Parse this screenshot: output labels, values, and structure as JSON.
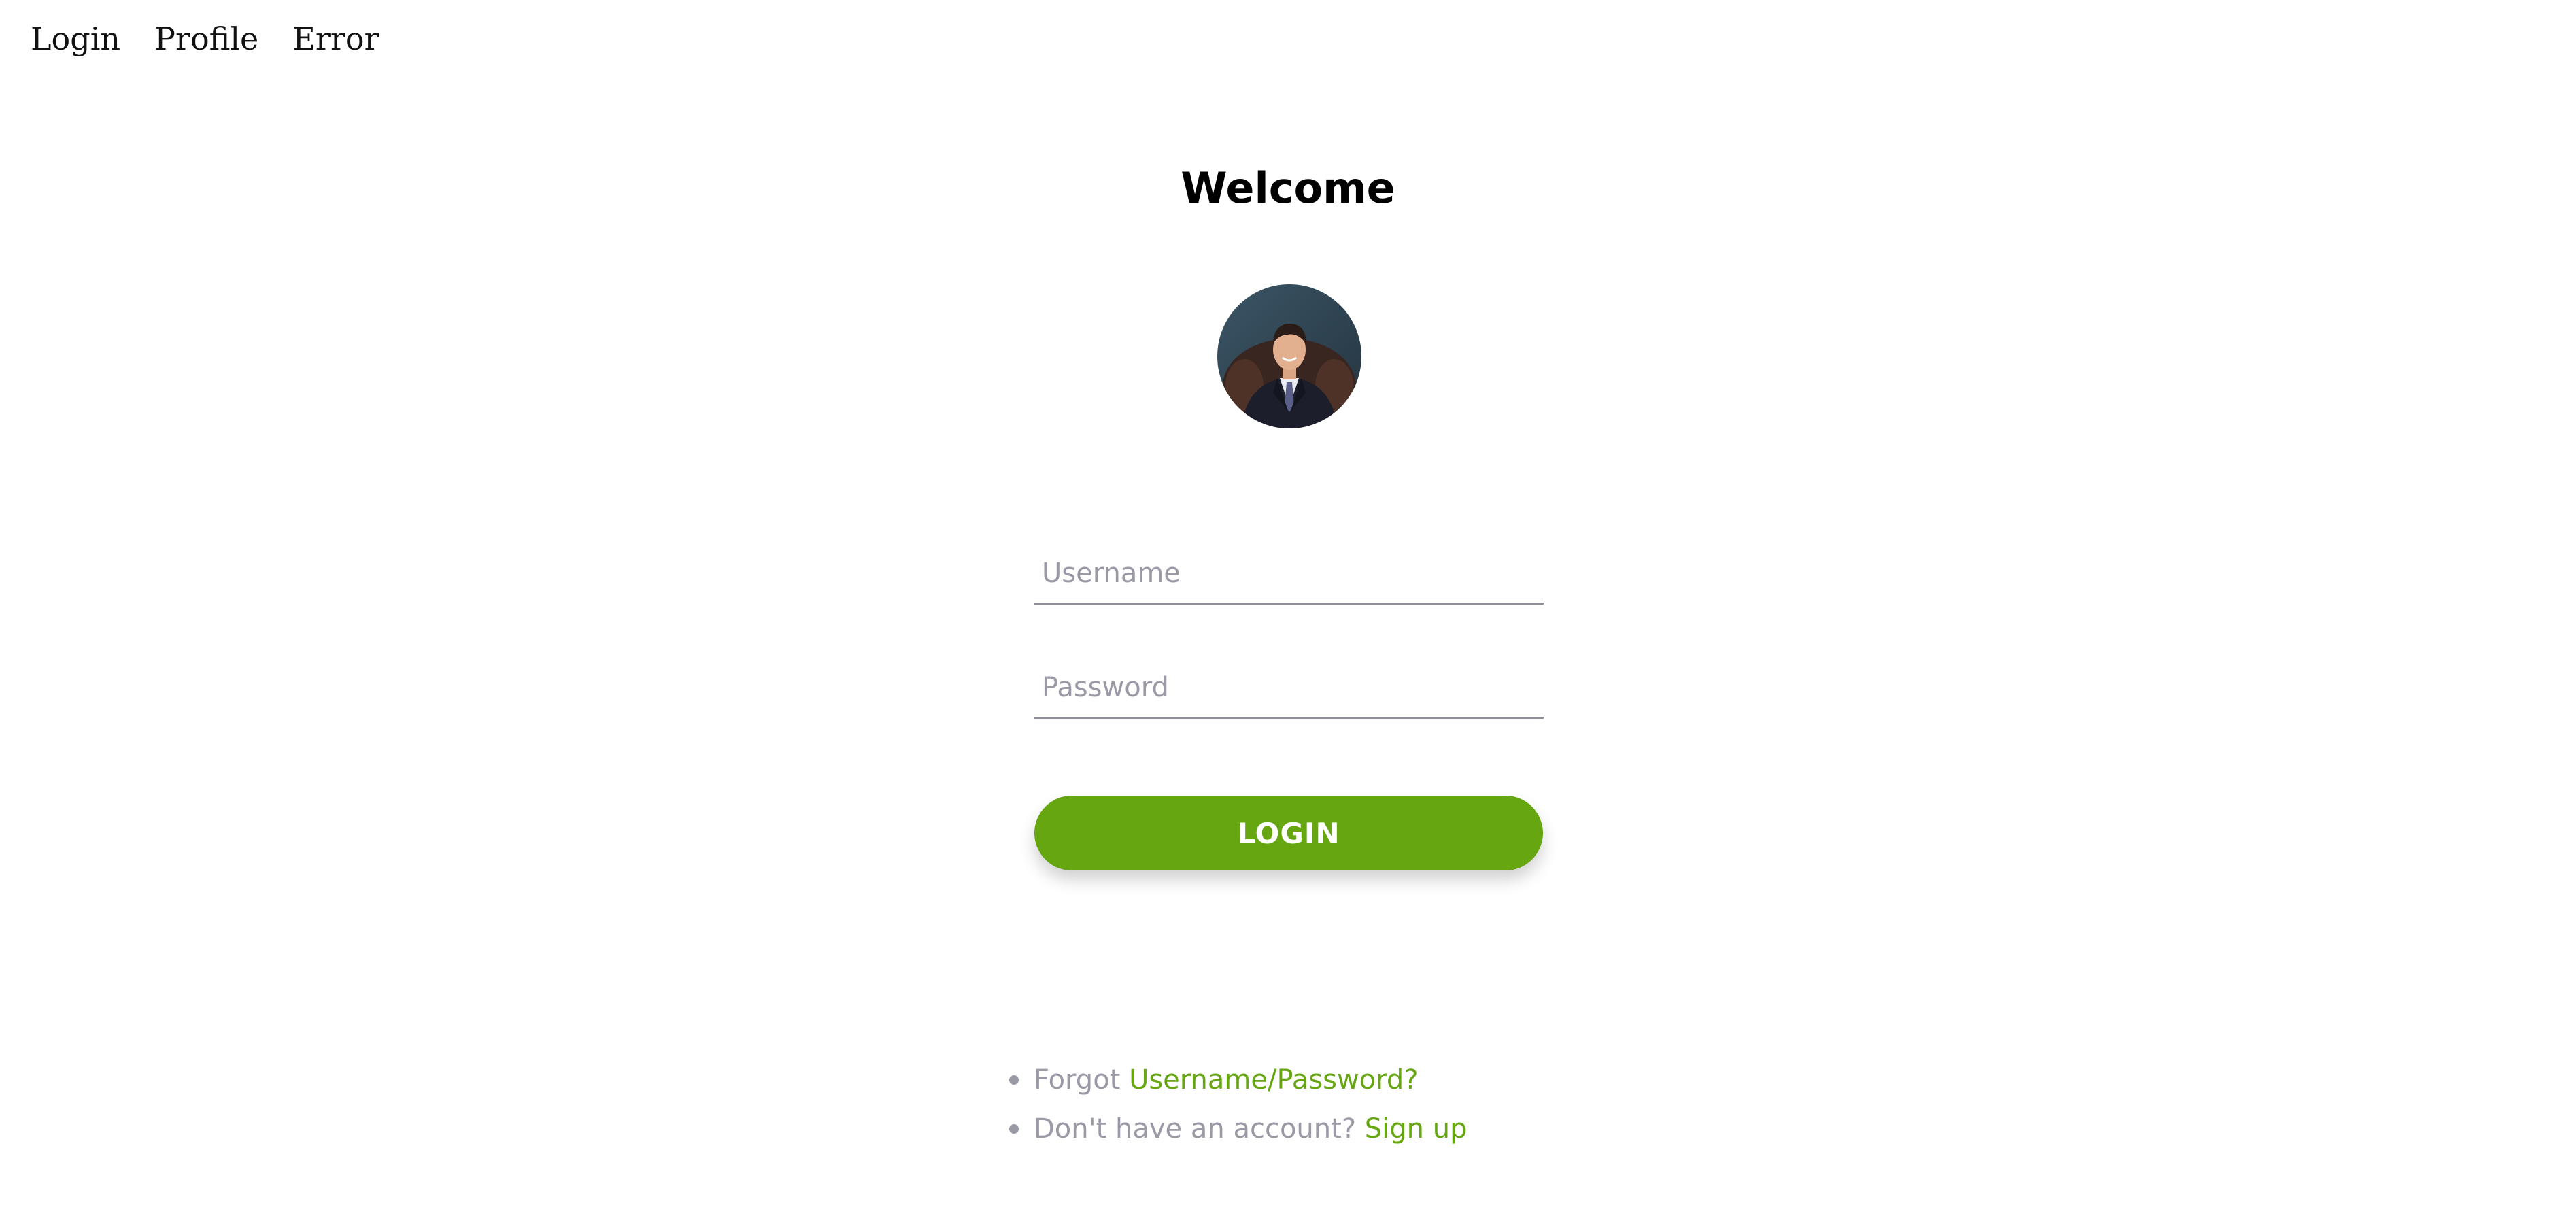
{
  "nav": {
    "items": [
      {
        "label": "Login"
      },
      {
        "label": "Profile"
      },
      {
        "label": "Error"
      }
    ]
  },
  "main": {
    "title": "Welcome",
    "avatar": {
      "icon": "profile-photo"
    },
    "username": {
      "placeholder": "Username",
      "value": ""
    },
    "password": {
      "placeholder": "Password",
      "value": ""
    },
    "login_button": "LOGIN"
  },
  "help": {
    "forgot_prefix": "Forgot",
    "forgot_link": "Username/Password?",
    "signup_prefix": "Don't have an account?",
    "signup_link": "Sign up"
  },
  "colors": {
    "accent": "#65a611",
    "muted_text": "#9a9aa6",
    "underline": "#8e8e99"
  }
}
